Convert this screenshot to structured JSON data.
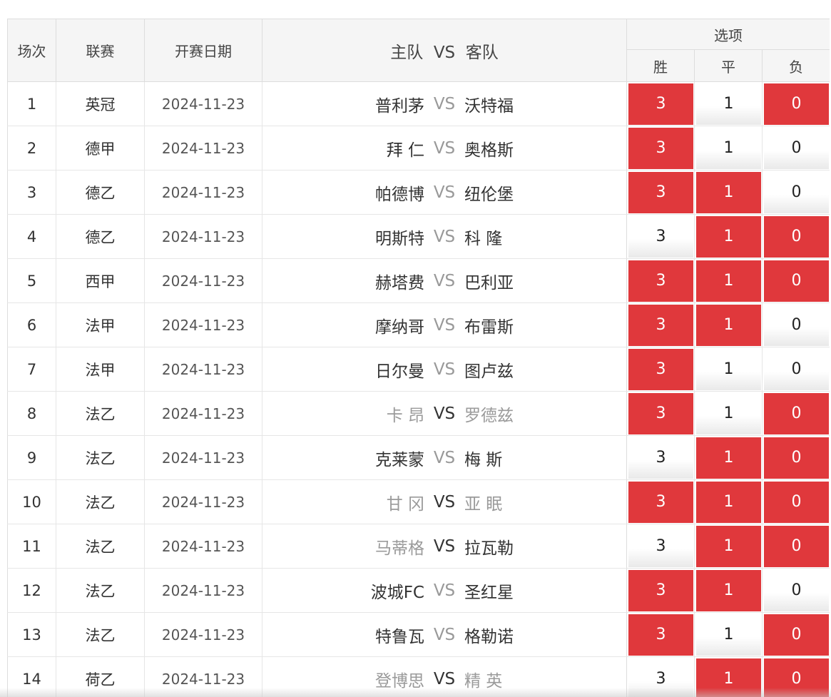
{
  "header": {
    "index": "场次",
    "league": "联赛",
    "date": "开赛日期",
    "match": "主队  VS  客队",
    "options": "选项",
    "win": "胜",
    "draw": "平",
    "lose": "负"
  },
  "colors": {
    "selected": "#e0383c",
    "header_bg": "#f5f5f5"
  },
  "rows": [
    {
      "index": "1",
      "league": "英冠",
      "date": "2024-11-23",
      "home": "普利茅",
      "vs": "VS",
      "away": "沃特福",
      "win": "3",
      "draw": "1",
      "lose": "0"
    },
    {
      "index": "2",
      "league": "德甲",
      "date": "2024-11-23",
      "home": "拜 仁",
      "vs": "VS",
      "away": "奥格斯",
      "win": "3",
      "draw": "1",
      "lose": "0"
    },
    {
      "index": "3",
      "league": "德乙",
      "date": "2024-11-23",
      "home": "帕德博",
      "vs": "VS",
      "away": "纽伦堡",
      "win": "3",
      "draw": "1",
      "lose": "0"
    },
    {
      "index": "4",
      "league": "德乙",
      "date": "2024-11-23",
      "home": "明斯特",
      "vs": "VS",
      "away": "科 隆",
      "win": "3",
      "draw": "1",
      "lose": "0"
    },
    {
      "index": "5",
      "league": "西甲",
      "date": "2024-11-23",
      "home": "赫塔费",
      "vs": "VS",
      "away": "巴利亚",
      "win": "3",
      "draw": "1",
      "lose": "0"
    },
    {
      "index": "6",
      "league": "法甲",
      "date": "2024-11-23",
      "home": "摩纳哥",
      "vs": "VS",
      "away": "布雷斯",
      "win": "3",
      "draw": "1",
      "lose": "0"
    },
    {
      "index": "7",
      "league": "法甲",
      "date": "2024-11-23",
      "home": "日尔曼",
      "vs": "VS",
      "away": "图卢兹",
      "win": "3",
      "draw": "1",
      "lose": "0"
    },
    {
      "index": "8",
      "league": "法乙",
      "date": "2024-11-23",
      "home": "卡 昂",
      "vs": "VS",
      "away": "罗德兹",
      "win": "3",
      "draw": "1",
      "lose": "0"
    },
    {
      "index": "9",
      "league": "法乙",
      "date": "2024-11-23",
      "home": "克莱蒙",
      "vs": "VS",
      "away": "梅 斯",
      "win": "3",
      "draw": "1",
      "lose": "0"
    },
    {
      "index": "10",
      "league": "法乙",
      "date": "2024-11-23",
      "home": "甘 冈",
      "vs": "VS",
      "away": "亚 眠",
      "win": "3",
      "draw": "1",
      "lose": "0"
    },
    {
      "index": "11",
      "league": "法乙",
      "date": "2024-11-23",
      "home": "马蒂格",
      "vs": "VS",
      "away": "拉瓦勒",
      "win": "3",
      "draw": "1",
      "lose": "0"
    },
    {
      "index": "12",
      "league": "法乙",
      "date": "2024-11-23",
      "home": "波城FC",
      "vs": "VS",
      "away": "圣红星",
      "win": "3",
      "draw": "1",
      "lose": "0"
    },
    {
      "index": "13",
      "league": "法乙",
      "date": "2024-11-23",
      "home": "特鲁瓦",
      "vs": "VS",
      "away": "格勒诺",
      "win": "3",
      "draw": "1",
      "lose": "0"
    },
    {
      "index": "14",
      "league": "荷乙",
      "date": "2024-11-23",
      "home": "登博思",
      "vs": "VS",
      "away": "精 英",
      "win": "3",
      "draw": "1",
      "lose": "0"
    }
  ]
}
